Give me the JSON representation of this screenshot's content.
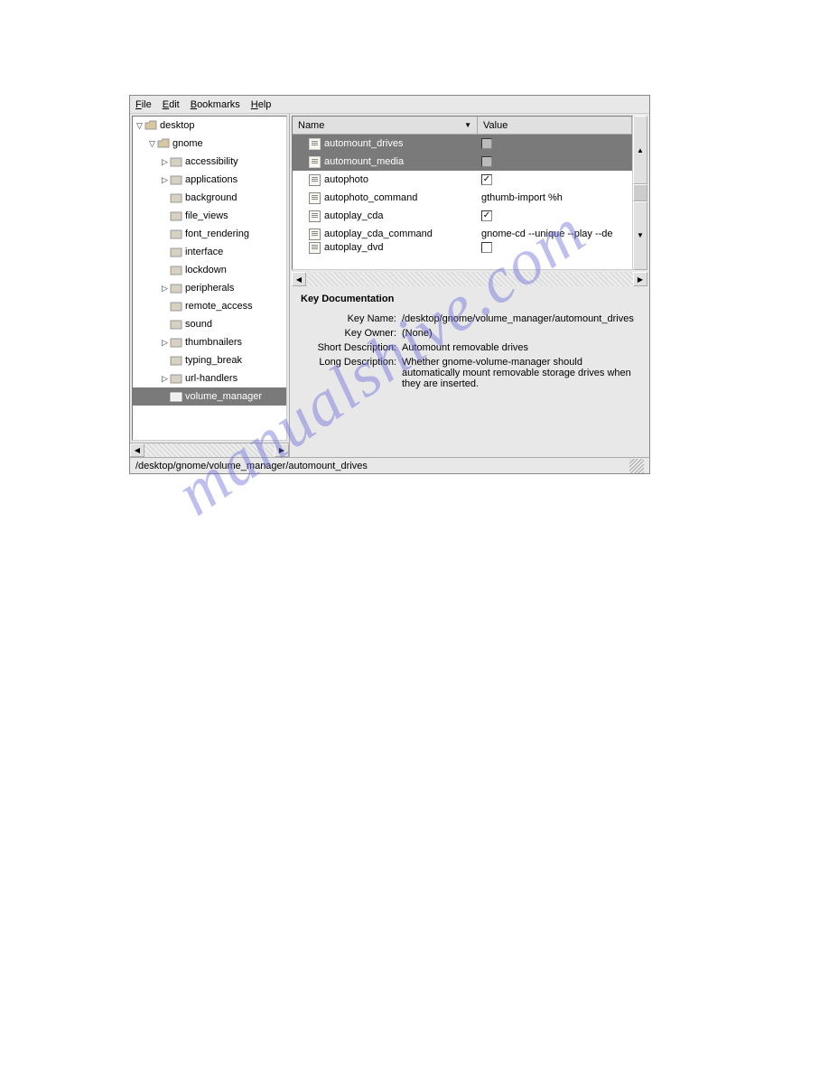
{
  "menu": {
    "file": "File",
    "edit": "Edit",
    "bookmarks": "Bookmarks",
    "help": "Help"
  },
  "tree": {
    "root": "desktop",
    "gnome": "gnome",
    "items": [
      {
        "label": "accessibility",
        "exp": true
      },
      {
        "label": "applications",
        "exp": true
      },
      {
        "label": "background",
        "exp": false
      },
      {
        "label": "file_views",
        "exp": false
      },
      {
        "label": "font_rendering",
        "exp": false
      },
      {
        "label": "interface",
        "exp": false
      },
      {
        "label": "lockdown",
        "exp": false
      },
      {
        "label": "peripherals",
        "exp": true
      },
      {
        "label": "remote_access",
        "exp": false
      },
      {
        "label": "sound",
        "exp": false
      },
      {
        "label": "thumbnailers",
        "exp": true
      },
      {
        "label": "typing_break",
        "exp": false
      },
      {
        "label": "url-handlers",
        "exp": true
      },
      {
        "label": "volume_manager",
        "exp": false,
        "selected": true
      }
    ]
  },
  "list": {
    "headers": {
      "name": "Name",
      "value": "Value"
    },
    "rows": [
      {
        "name": "automount_drives",
        "type": "check",
        "checked": false,
        "sel": true
      },
      {
        "name": "automount_media",
        "type": "check",
        "checked": false,
        "sel": true
      },
      {
        "name": "autophoto",
        "type": "check",
        "checked": true
      },
      {
        "name": "autophoto_command",
        "type": "text",
        "value": "gthumb-import %h"
      },
      {
        "name": "autoplay_cda",
        "type": "check",
        "checked": true
      },
      {
        "name": "autoplay_cda_command",
        "type": "text",
        "value": "gnome-cd --unique --play --de"
      },
      {
        "name": "autoplay_dvd",
        "type": "check",
        "checked": false,
        "partial": true
      }
    ]
  },
  "doc": {
    "title": "Key Documentation",
    "labels": {
      "keyname": "Key Name:",
      "owner": "Key Owner:",
      "short": "Short Description:",
      "long": "Long Description:"
    },
    "keyname": "/desktop/gnome/volume_manager/automount_drives",
    "owner": "(None)",
    "short": "Automount removable drives",
    "long": "Whether gnome-volume-manager should automatically mount removable storage drives when they are inserted."
  },
  "status": "/desktop/gnome/volume_manager/automount_drives",
  "watermark": "manualshive.com"
}
